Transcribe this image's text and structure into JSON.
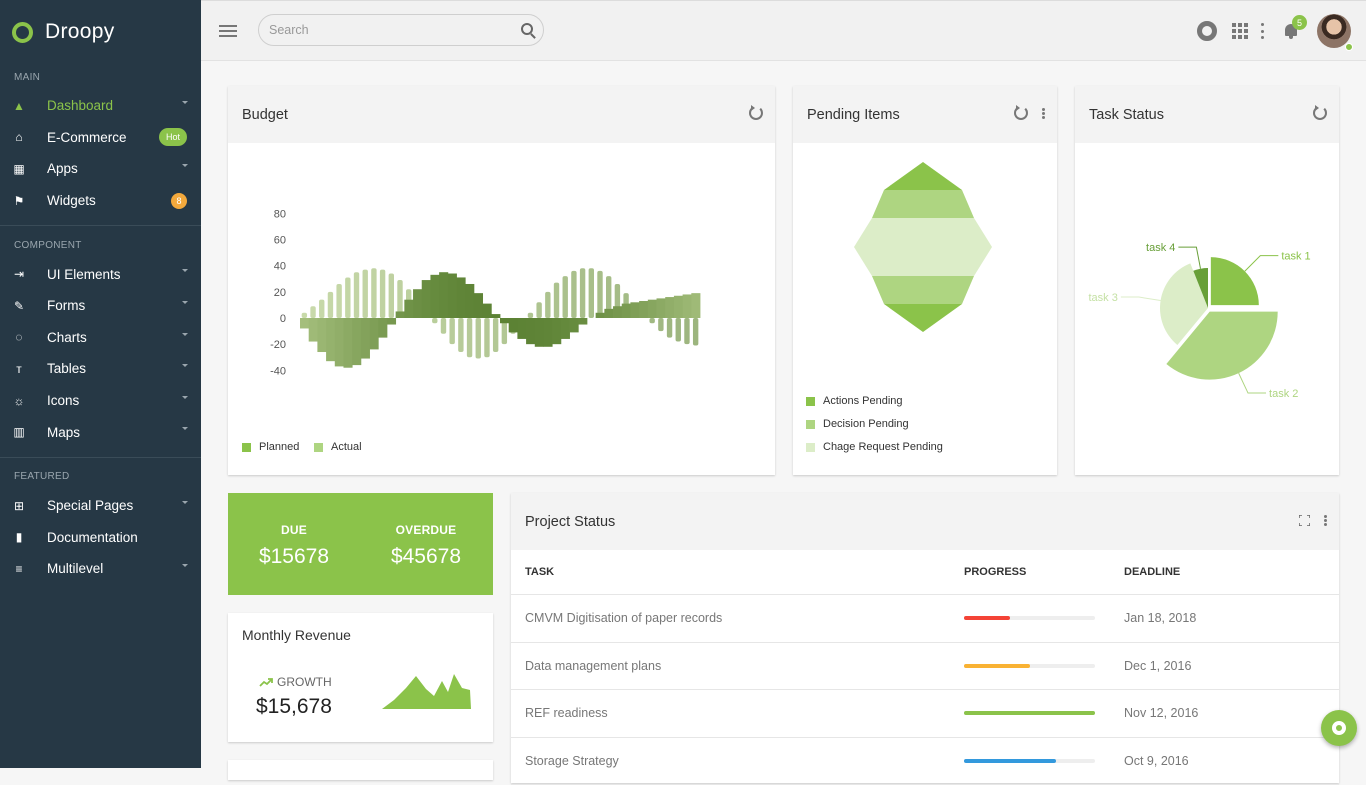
{
  "app": {
    "name": "Droopy"
  },
  "sidebar": {
    "sections": [
      {
        "title": "MAIN",
        "items": [
          {
            "label": "Dashboard",
            "icon": "dashboard-icon",
            "active": true,
            "caret": true
          },
          {
            "label": "E-Commerce",
            "icon": "basket-icon",
            "badge": "Hot"
          },
          {
            "label": "Apps",
            "icon": "apps-icon",
            "caret": true
          },
          {
            "label": "Widgets",
            "icon": "flag-icon",
            "count": "8"
          }
        ]
      },
      {
        "title": "COMPONENT",
        "items": [
          {
            "label": "UI Elements",
            "icon": "ui-elements-icon",
            "caret": true
          },
          {
            "label": "Forms",
            "icon": "pencil-icon",
            "caret": true
          },
          {
            "label": "Charts",
            "icon": "chart-ring-icon",
            "caret": true
          },
          {
            "label": "Tables",
            "icon": "tables-icon",
            "caret": true
          },
          {
            "label": "Icons",
            "icon": "icons-icon",
            "caret": true
          },
          {
            "label": "Maps",
            "icon": "map-icon",
            "caret": true
          }
        ]
      },
      {
        "title": "FEATURED",
        "items": [
          {
            "label": "Special Pages",
            "icon": "special-pages-icon",
            "caret": true
          },
          {
            "label": "Documentation",
            "icon": "book-icon"
          },
          {
            "label": "Multilevel",
            "icon": "filter-icon",
            "caret": true
          }
        ]
      }
    ]
  },
  "topbar": {
    "search_placeholder": "Search",
    "notification_count": "5"
  },
  "budget": {
    "title": "Budget",
    "legend": [
      {
        "label": "Planned",
        "color": "#8bc34a"
      },
      {
        "label": "Actual",
        "color": "#aed581"
      }
    ]
  },
  "chart_data": [
    {
      "type": "bar",
      "title": "Budget",
      "y_ticks": [
        "80",
        "60",
        "40",
        "20",
        "0",
        "-20",
        "-40"
      ],
      "ylim": [
        -40,
        80
      ],
      "series": [
        {
          "name": "Planned",
          "values": [
            -8,
            -18,
            -26,
            -33,
            -37,
            -38,
            -36,
            -31,
            -24,
            -15,
            -5,
            5,
            14,
            22,
            29,
            33,
            35,
            34,
            31,
            26,
            19,
            11,
            3,
            -4,
            -11,
            -16,
            -20,
            -22,
            -22,
            -20,
            -16,
            -11,
            -5,
            0,
            4,
            7,
            9,
            11,
            12,
            13,
            14,
            15,
            16,
            17,
            18,
            19
          ]
        },
        {
          "name": "Actual",
          "values": [
            4,
            9,
            14,
            20,
            26,
            31,
            35,
            37,
            38,
            37,
            34,
            29,
            22,
            14,
            5,
            -4,
            -12,
            -20,
            -26,
            -30,
            -31,
            -30,
            -26,
            -20,
            -12,
            -4,
            4,
            12,
            20,
            27,
            32,
            36,
            38,
            38,
            36,
            32,
            26,
            19,
            11,
            3,
            -4,
            -10,
            -15,
            -18,
            -20,
            -21
          ]
        }
      ]
    },
    {
      "type": "pie",
      "title": "Task Status",
      "categories": [
        "task 1",
        "task 2",
        "task 3",
        "task 4"
      ],
      "values": [
        25,
        36,
        33,
        6
      ],
      "colors": [
        "#8bc34a",
        "#aed581",
        "#dcedc8",
        "#689f38"
      ]
    }
  ],
  "pending": {
    "title": "Pending Items",
    "legend": [
      {
        "label": "Actions Pending",
        "color": "#8bc34a"
      },
      {
        "label": "Decision Pending",
        "color": "#aed581"
      },
      {
        "label": "Chage Request Pending",
        "color": "#dcedc8"
      }
    ]
  },
  "task_status": {
    "title": "Task Status"
  },
  "due": {
    "due_label": "DUE",
    "due_value": "$15678",
    "overdue_label": "OVERDUE",
    "overdue_value": "$45678"
  },
  "revenue": {
    "title": "Monthly Revenue",
    "growth_label": "GROWTH",
    "value": "$15,678"
  },
  "project": {
    "title": "Project Status",
    "headers": [
      "TASK",
      "PROGRESS",
      "DEADLINE"
    ],
    "rows": [
      {
        "task": "CMVM Digitisation of paper records",
        "progress": 0.35,
        "color": "#f44336",
        "deadline": "Jan 18, 2018"
      },
      {
        "task": "Data management plans",
        "progress": 0.5,
        "color": "#f9b233",
        "deadline": "Dec 1, 2016"
      },
      {
        "task": "REF readiness",
        "progress": 1.0,
        "color": "#8bc34a",
        "deadline": "Nov 12, 2016"
      },
      {
        "task": "Storage Strategy",
        "progress": 0.7,
        "color": "#3399dd",
        "deadline": "Oct 9, 2016"
      }
    ]
  }
}
